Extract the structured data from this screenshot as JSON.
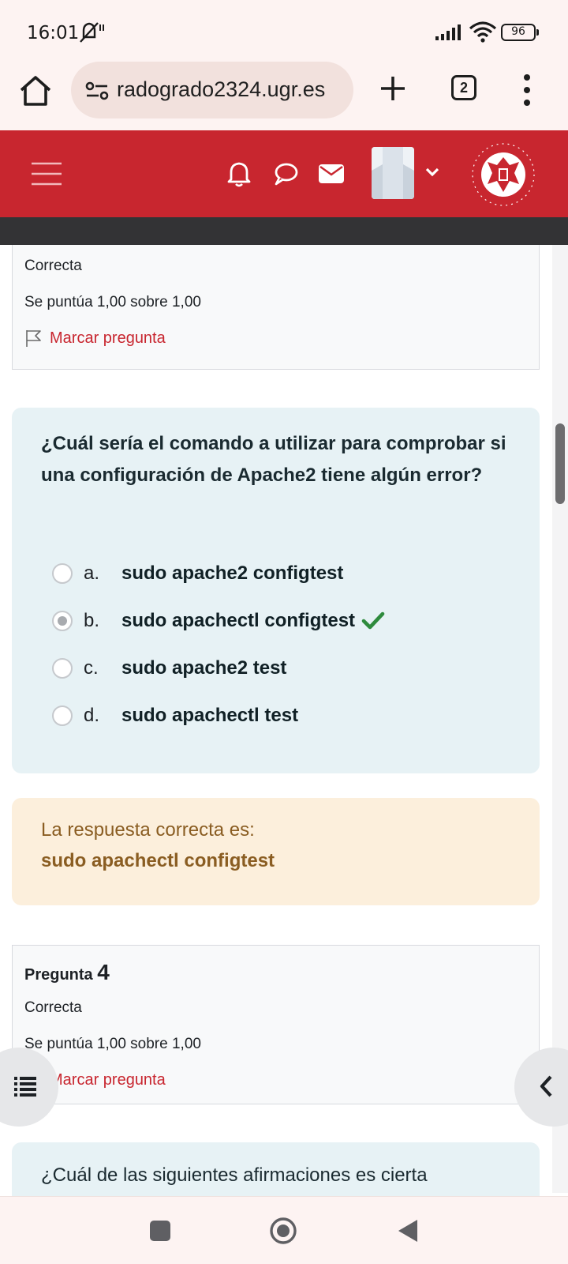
{
  "status_bar": {
    "time": "16:01",
    "battery": "96"
  },
  "browser": {
    "url": "radogrado2324.ugr.es",
    "tab_count": "2"
  },
  "colors": {
    "brand_red": "#c8262f",
    "question_bg": "#e7f2f5",
    "feedback_bg": "#fcefdc",
    "correct_green": "#2e8b3d"
  },
  "previous_question": {
    "state": "Correcta",
    "grade": "Se puntúa 1,00 sobre 1,00",
    "flag_label": "Marcar pregunta"
  },
  "question": {
    "text": "¿Cuál sería el comando a utilizar para comprobar si una configuración de Apache2 tiene algún error?",
    "answers": [
      {
        "letter": "a.",
        "text": "sudo apache2 configtest",
        "selected": false
      },
      {
        "letter": "b.",
        "text": "sudo apachectl configtest",
        "selected": true,
        "correct": true
      },
      {
        "letter": "c.",
        "text": "sudo apache2 test",
        "selected": false
      },
      {
        "letter": "d.",
        "text": "sudo apachectl test",
        "selected": false
      }
    ]
  },
  "feedback": {
    "label": "La respuesta correcta es:",
    "answer": "sudo apachectl configtest"
  },
  "question4": {
    "label": "Pregunta",
    "number": "4",
    "state": "Correcta",
    "grade": "Se puntúa 1,00 sobre 1,00",
    "flag_label": "Marcar pregunta"
  },
  "next_question": {
    "text": "¿Cuál de las siguientes afirmaciones es cierta"
  }
}
